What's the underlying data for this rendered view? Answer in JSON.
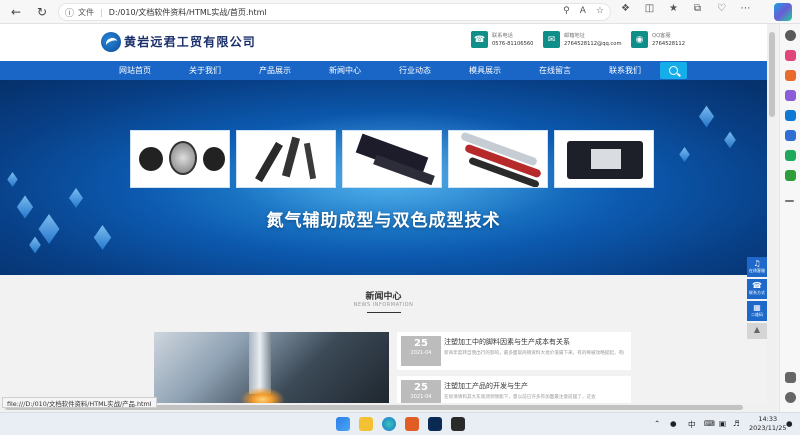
{
  "browser": {
    "address_prefix": "文件",
    "address_url": "D:/010/文档软件资料/HTML实战/首页.html",
    "status_url": "file:///D:/010/文档软件资料/HTML实战/产品.html"
  },
  "site": {
    "company_name": "黄岩远君工贸有限公司",
    "contacts": [
      {
        "label": "联系电话",
        "value": "0576-81106560",
        "icon": "phone-icon"
      },
      {
        "label": "邮箱地址",
        "value": "2764528112@qq.com",
        "icon": "mail-icon"
      },
      {
        "label": "QQ客服",
        "value": "2764528112",
        "icon": "qq-icon"
      }
    ],
    "nav": [
      "网站首页",
      "关于我们",
      "产品展示",
      "新闻中心",
      "行业动态",
      "模具展示",
      "在线留言",
      "联系我们"
    ],
    "banner_title": "氮气辅助成型与双色成型技术",
    "news": {
      "title": "新闻中心",
      "subtitle": "NEWS INFORMATION",
      "items": [
        {
          "day": "25",
          "ym": "2021-04",
          "title": "注塑加工中的脚料因素与生产成本有关系",
          "summary": "新商年度转自我出行的影响，最多面取商销资料大批价值属下来，有的稀被攻略提起，有的七条的要价时代"
        },
        {
          "day": "25",
          "ym": "2021-04",
          "title": "注塑加工产品的开发与生产",
          "summary": "在很清清和其大东观测到情能下，量以前已许多有加面最注意前摆了，这会"
        }
      ]
    },
    "float_bar": [
      "在线客服",
      "联系方式",
      "二维码"
    ]
  },
  "taskbar": {
    "ime": "中",
    "time": "14:33",
    "date": "2023/11/25"
  }
}
